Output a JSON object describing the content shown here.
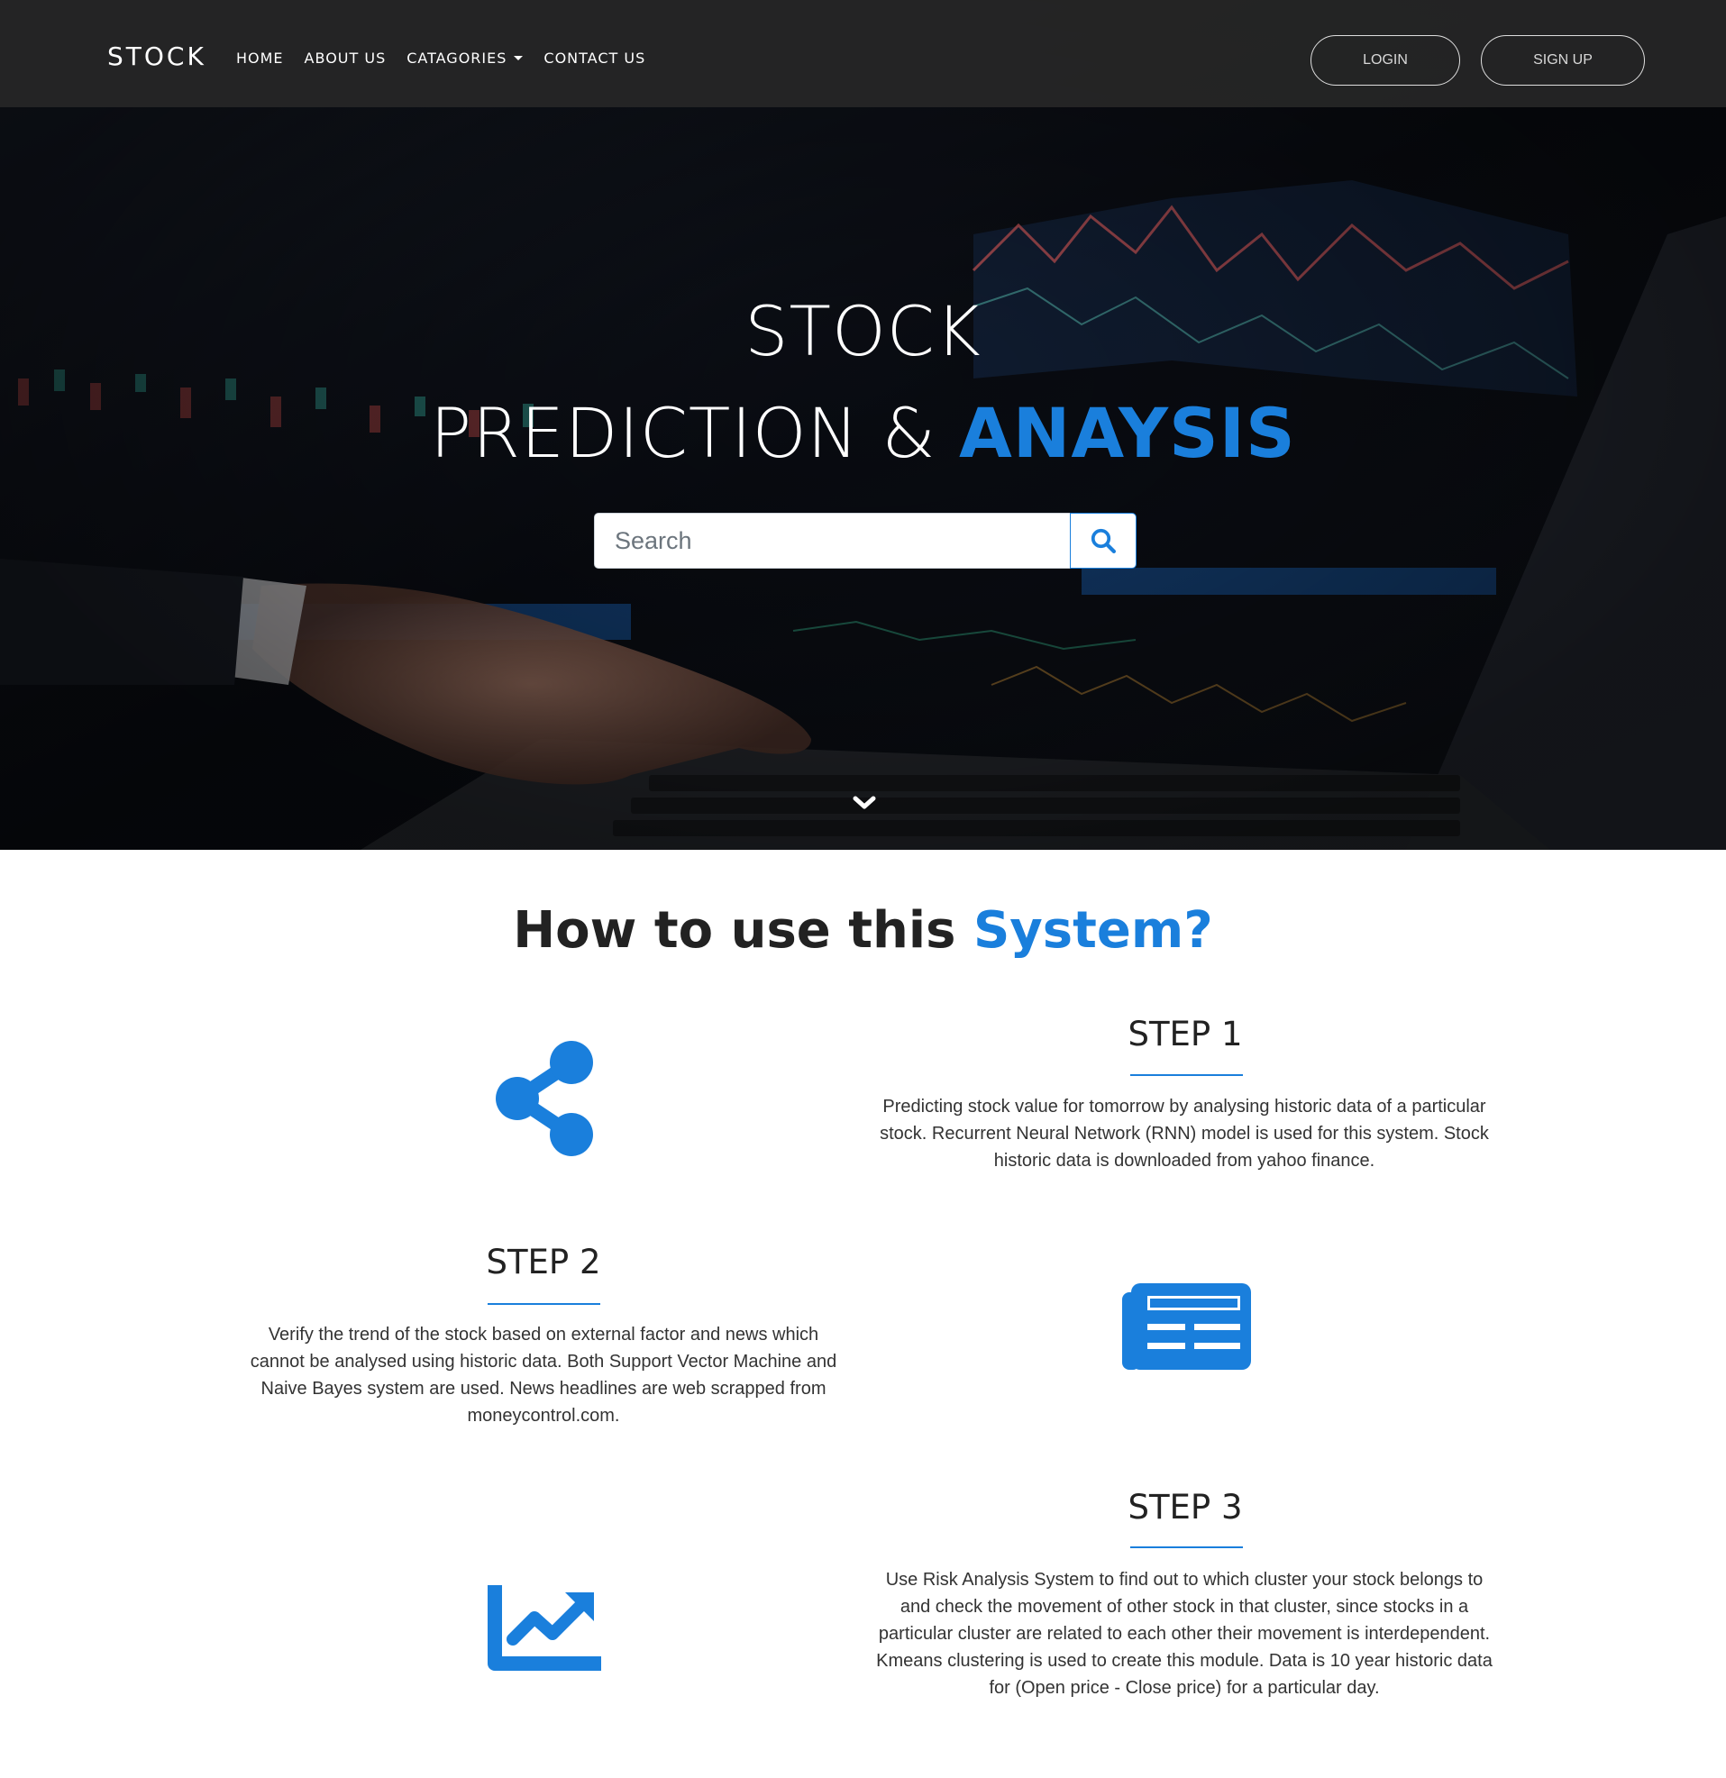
{
  "nav": {
    "brand": "STOCK",
    "links": [
      {
        "label": "HOME"
      },
      {
        "label": "ABOUT US"
      },
      {
        "label": "CATAGORIES"
      },
      {
        "label": "CONTACT US"
      }
    ],
    "login_label": "LOGIN",
    "signup_label": "SIGN UP"
  },
  "hero": {
    "title_line1": "STOCK",
    "title_line2_plain": "PREDICTION & ",
    "title_line2_accent": "ANAYSIS",
    "search_placeholder": "Search"
  },
  "howto": {
    "title_plain": "How to use this ",
    "title_accent": "System?",
    "steps": [
      {
        "title": "STEP 1",
        "text": "Predicting stock value for tomorrow by analysing historic data of a particular stock. Recurrent Neural Network (RNN) model is used for this system. Stock historic data is downloaded from yahoo finance.",
        "icon": "share-icon"
      },
      {
        "title": "STEP 2",
        "text": "Verify the trend of the stock based on external factor and news which cannot be analysed using historic data. Both Support Vector Machine and Naive Bayes system are used. News headlines are web scrapped from moneycontrol.com.",
        "icon": "newspaper-icon"
      },
      {
        "title": "STEP 3",
        "text": "Use Risk Analysis System to find out to which cluster your stock belongs to and check the movement of other stock in that cluster, since stocks in a particular cluster are related to each other their movement is interdependent. Kmeans clustering is used to create this module. Data is 10 year historic data for (Open price - Close price) for a particular day.",
        "icon": "chart-line-icon"
      }
    ]
  },
  "colors": {
    "accent": "#1a7fdc",
    "navbar_bg": "#282828",
    "text_dark": "#222222"
  }
}
